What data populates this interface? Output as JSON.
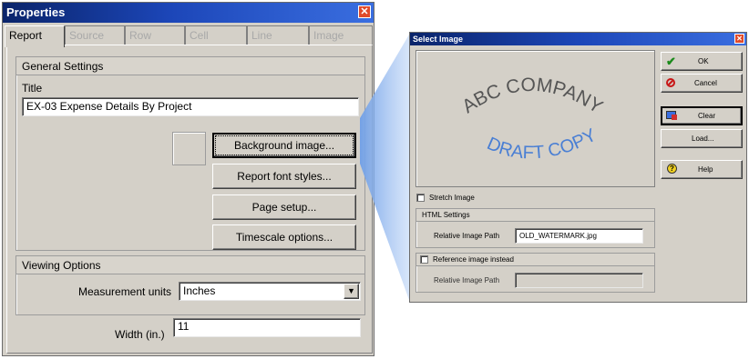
{
  "properties": {
    "title": "Properties",
    "tabs": [
      "Report",
      "Source",
      "Row",
      "Cell",
      "Line",
      "Image"
    ],
    "general_settings": "General Settings",
    "title_label": "Title",
    "title_value": "EX-03  Expense Details By Project",
    "buttons": {
      "background_image": "Background image...",
      "report_font_styles": "Report font styles...",
      "page_setup": "Page setup...",
      "timescale_options": "Timescale options..."
    },
    "viewing_options": "Viewing Options",
    "measurement_units_label": "Measurement units",
    "measurement_units_value": "Inches",
    "width_label": "Width (in.)",
    "width_value": "11"
  },
  "select_image": {
    "title": "Select Image",
    "preview_line1": "ABC COMPANY",
    "preview_line2": "DRAFT COPY",
    "buttons": {
      "ok": "OK",
      "cancel": "Cancel",
      "clear": "Clear",
      "load": "Load...",
      "help": "Help"
    },
    "stretch_image": "Stretch Image",
    "html_settings": "HTML Settings",
    "relative_image_path_label": "Relative Image Path",
    "relative_image_path_value": "OLD_WATERMARK.jpg",
    "reference_image_instead": "Reference image instead",
    "relative_image_path_label2": "Relative Image Path",
    "relative_image_path_value2": ""
  },
  "colors": {
    "titlebar": "#0a246a",
    "dialog_bg": "#d4d0c8",
    "watermark_gray": "#555555",
    "watermark_blue": "#4a7fd4"
  },
  "icons": {
    "ok": "check-icon",
    "cancel": "no-entry-icon",
    "clear": "clear-image-icon",
    "help": "help-icon",
    "close": "close-icon"
  }
}
